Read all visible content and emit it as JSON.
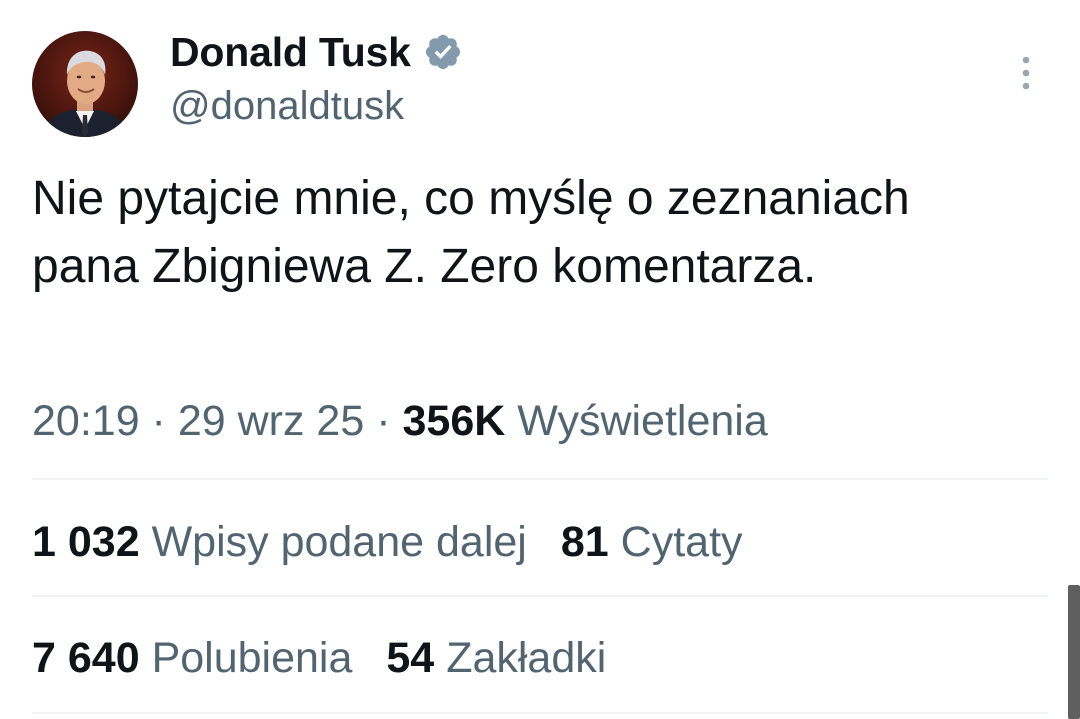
{
  "author": {
    "display_name": "Donald Tusk",
    "handle": "@donaldtusk",
    "avatar": "profile-photo",
    "verified_icon": "verified-badge-icon",
    "badge_color": "#829aab"
  },
  "tweet": {
    "text": "Nie pytajcie mnie, co myślę o zeznaniach pana Zbigniewa Z. Zero komentarza.",
    "time": "20:19",
    "date": "29 wrz 25",
    "separator": " · ",
    "views_count": "356K",
    "views_label": "Wyświetlenia"
  },
  "stats": {
    "reposts_count": "1 032",
    "reposts_label": "Wpisy podane dalej",
    "quotes_count": "81",
    "quotes_label": "Cytaty",
    "likes_count": "7 640",
    "likes_label": "Polubienia",
    "bookmarks_count": "54",
    "bookmarks_label": "Zakładki"
  },
  "colors": {
    "text_primary": "#0f1419",
    "text_secondary": "#536471",
    "divider": "#eff3f4"
  }
}
